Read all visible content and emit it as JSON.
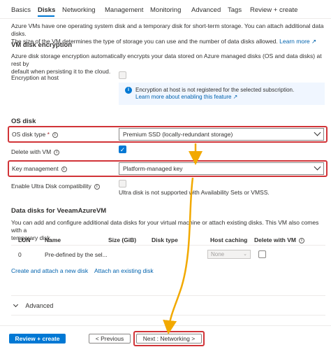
{
  "tabs": [
    "Basics",
    "Disks",
    "Networking",
    "Management",
    "Monitoring",
    "Advanced",
    "Tags",
    "Review + create"
  ],
  "intro": {
    "line1": "Azure VMs have one operating system disk and a temporary disk for short-term storage. You can attach additional data disks.",
    "line2": "The size of the VM determines the type of storage you can use and the number of data disks allowed.",
    "learn_more": "Learn more"
  },
  "encryption": {
    "heading": "VM disk encryption",
    "desc_line1": "Azure disk storage encryption automatically encrypts your data stored on Azure managed disks (OS and data disks) at rest by",
    "desc_line2": "default when persisting it to the cloud.",
    "at_host_label": "Encryption at host",
    "info_text": "Encryption at host is not registered for the selected subscription.",
    "info_link": "Learn more about enabling this feature"
  },
  "os_disk": {
    "heading": "OS disk",
    "type_label": "OS disk type",
    "type_required": "*",
    "type_value": "Premium SSD (locally-redundant storage)",
    "delete_label": "Delete with VM",
    "key_label": "Key management",
    "key_value": "Platform-managed key",
    "ultra_label": "Enable Ultra Disk compatibility",
    "ultra_note": "Ultra disk is not supported with Availability Sets or VMSS."
  },
  "data_disks": {
    "heading": "Data disks for VeeamAzureVM",
    "desc_line1": "You can add and configure additional data disks for your virtual machine or attach existing disks. This VM also comes with a",
    "desc_line2": "temporary disk.",
    "columns": [
      "LUN",
      "Name",
      "Size (GiB)",
      "Disk type",
      "Host caching",
      "Delete with VM"
    ],
    "row": {
      "lun": "0",
      "name": "Pre-defined by the sel...",
      "caching": "None"
    },
    "create_link": "Create and attach a new disk",
    "attach_link": "Attach an existing disk"
  },
  "advanced": {
    "label": "Advanced"
  },
  "footer": {
    "review": "Review + create",
    "previous": "< Previous",
    "next": "Next : Networking >"
  },
  "colors": {
    "accent": "#0078d4",
    "highlight": "#d13438",
    "arrow": "#f2a900"
  }
}
